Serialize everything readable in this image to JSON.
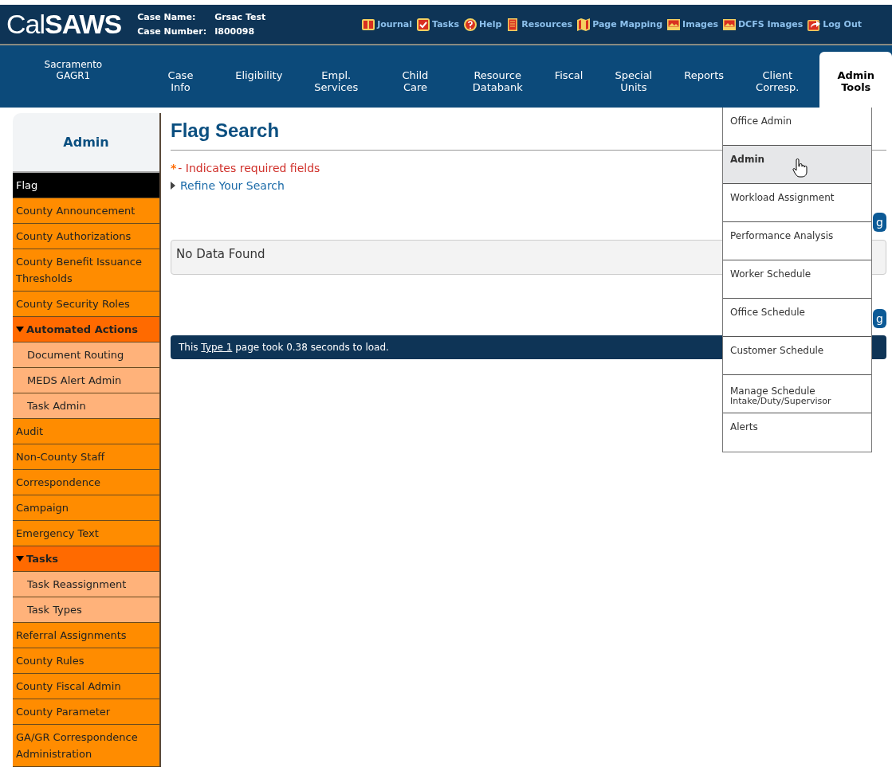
{
  "header": {
    "logo": "Cal**SAWS**",
    "case_name_label": "Case Name:",
    "case_name": "Grsac Test",
    "case_number_label": "Case Number:",
    "case_number": "I800098",
    "links": [
      {
        "label": "Journal"
      },
      {
        "label": "Tasks"
      },
      {
        "label": "Help"
      },
      {
        "label": "Resources"
      },
      {
        "label": "Page Mapping"
      },
      {
        "label": "Images"
      },
      {
        "label": "DCFS Images"
      },
      {
        "label": "Log Out"
      }
    ]
  },
  "nav": {
    "office": "Sacramento\nGAGR1",
    "tabs": [
      {
        "label": "Case Info",
        "selected": false
      },
      {
        "label": "Eligibility",
        "selected": false
      },
      {
        "label": "Empl.\nServices",
        "selected": false
      },
      {
        "label": "Child Care",
        "selected": false
      },
      {
        "label": "Resource\nDatabank",
        "selected": false
      },
      {
        "label": "Fiscal",
        "selected": false
      },
      {
        "label": "Special\nUnits",
        "selected": false
      },
      {
        "label": "Reports",
        "selected": false
      },
      {
        "label": "Client\nCorresp.",
        "selected": false
      },
      {
        "label": "Admin\nTools",
        "selected": true
      }
    ]
  },
  "sidebar": {
    "title": "Admin",
    "items": [
      {
        "label": "Flag",
        "kind": "link",
        "selected": true
      },
      {
        "label": "County Announcement",
        "kind": "link",
        "selected": false
      },
      {
        "label": "County Authorizations",
        "kind": "link",
        "selected": false
      },
      {
        "label": "County Benefit Issuance Thresholds",
        "kind": "link",
        "selected": false
      },
      {
        "label": "County Security Roles",
        "kind": "link",
        "selected": false
      },
      {
        "label": "Automated Actions",
        "kind": "group",
        "expanded": true,
        "selected": false,
        "children": [
          {
            "label": "Document Routing",
            "selected": false
          },
          {
            "label": "MEDS Alert Admin",
            "selected": false
          },
          {
            "label": "Task Admin",
            "selected": false
          }
        ]
      },
      {
        "label": "Audit",
        "kind": "link",
        "selected": false
      },
      {
        "label": "Non-County Staff",
        "kind": "link",
        "selected": false
      },
      {
        "label": "Correspondence",
        "kind": "link",
        "selected": false
      },
      {
        "label": "Campaign",
        "kind": "link",
        "selected": false
      },
      {
        "label": "Emergency Text",
        "kind": "link",
        "selected": false
      },
      {
        "label": "Tasks",
        "kind": "group",
        "expanded": true,
        "selected": false,
        "children": [
          {
            "label": "Task Reassignment",
            "selected": false
          },
          {
            "label": "Task Types",
            "selected": false
          }
        ]
      },
      {
        "label": "Referral Assignments",
        "kind": "link",
        "selected": false
      },
      {
        "label": "County Rules",
        "kind": "link",
        "selected": false
      },
      {
        "label": "County Fiscal Admin",
        "kind": "link",
        "selected": false
      },
      {
        "label": "County Parameter",
        "kind": "link",
        "selected": false
      },
      {
        "label": "GA/GR Correspondence Administration",
        "kind": "link",
        "selected": false
      }
    ]
  },
  "main": {
    "title": "Flag Search",
    "required_mark": "*",
    "required_note": "- Indicates required fields",
    "refine": "Refine Your Search",
    "top_button": "g",
    "result": "No Data Found",
    "bottom_button": "g",
    "footer": {
      "before": "This",
      "link": "Type 1",
      "after": "page took 0.38 seconds to load."
    }
  },
  "dropdown": {
    "items": [
      {
        "label": "Office Admin",
        "selected": false
      },
      {
        "label": "Admin",
        "selected": true
      },
      {
        "label": "Workload Assignment",
        "selected": false
      },
      {
        "label": "Performance Analysis",
        "selected": false
      },
      {
        "label": "Worker Schedule",
        "selected": false
      },
      {
        "label": "Office Schedule",
        "selected": false
      },
      {
        "label": "Customer Schedule",
        "selected": false
      },
      {
        "label": "Manage Schedule",
        "sublabel": "Intake/Duty/Supervisor",
        "selected": false
      },
      {
        "label": "Alerts",
        "selected": false
      }
    ]
  }
}
